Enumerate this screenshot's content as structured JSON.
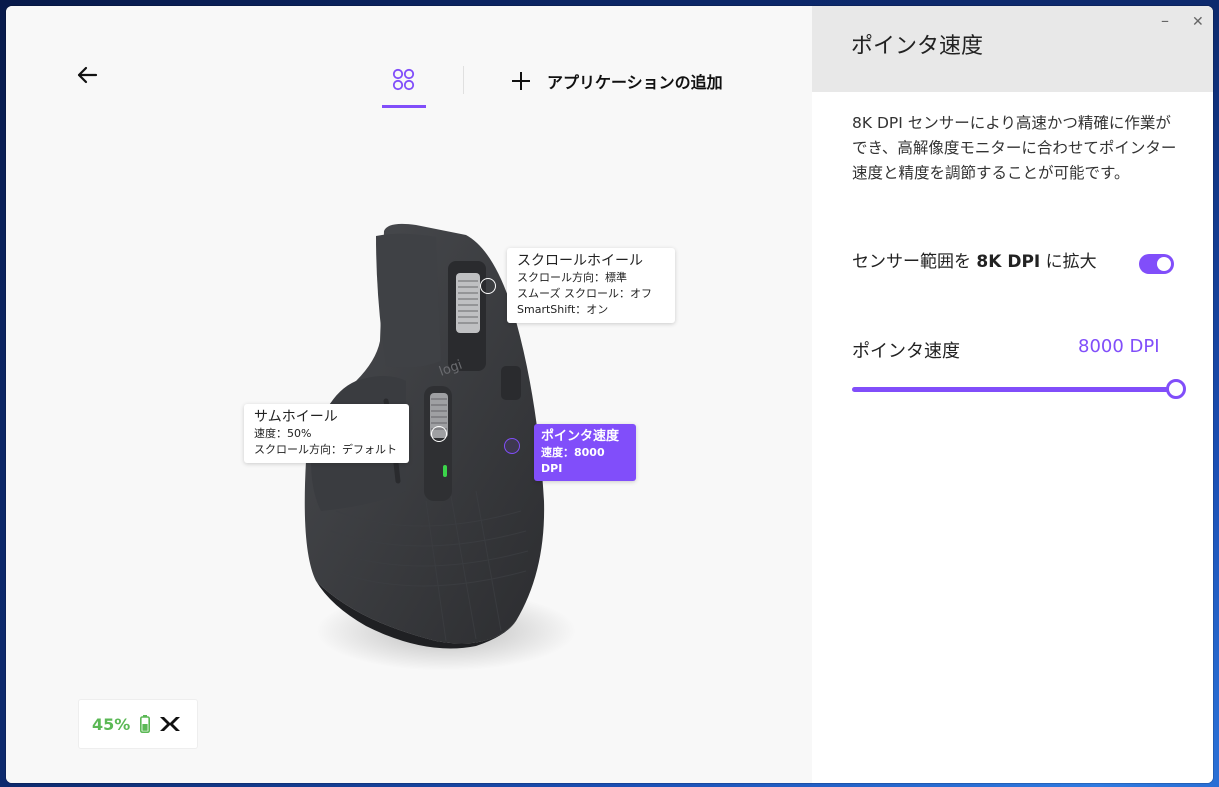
{
  "nav": {
    "back_icon": "back-arrow-icon",
    "devices_icon": "four-circles-icon",
    "add_app_label": "アプリケーションの追加"
  },
  "callouts": {
    "scroll_wheel": {
      "title": "スクロールホイール",
      "lines": [
        "スクロール方向：標準",
        "スムーズ スクロール：オフ",
        "SmartShift：オン"
      ]
    },
    "thumb_wheel": {
      "title": "サムホイール",
      "lines": [
        "速度：50%",
        "スクロール方向：デフォルト"
      ]
    },
    "pointer_speed": {
      "title": "ポインタ速度",
      "line": "速度：8000 DPI"
    }
  },
  "battery": {
    "percent": "45%",
    "color": "#5bb855"
  },
  "panel": {
    "title": "ポインタ速度",
    "description": "8K DPI センサーにより高速かつ精確に作業ができ、高解像度モニターに合わせてポインター速度と精度を調節することが可能です。",
    "toggle_pre": "センサー範囲を ",
    "toggle_bold": "8K DPI",
    "toggle_post": " に拡大",
    "toggle_on": true,
    "speed_label": "ポインタ速度",
    "speed_value": "8000 DPI",
    "slider_fraction": 1.0
  },
  "window_buttons": {
    "minimize": "–",
    "close": "✕"
  },
  "colors": {
    "accent": "#814efa",
    "battery_green": "#5bb855"
  }
}
